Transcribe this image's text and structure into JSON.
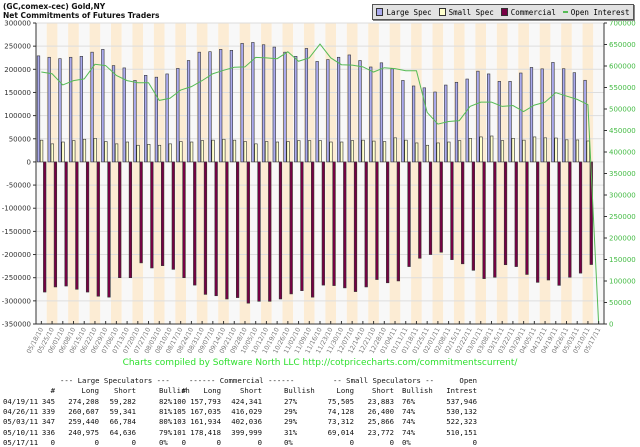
{
  "header": {
    "line1": "(GC,comex-cec) Gold,NY",
    "line2": "Net Commitments of Futures Traders"
  },
  "legend": [
    {
      "label": "Large Spec",
      "color": "#aaaaee",
      "kind": "box"
    },
    {
      "label": "Small Spec",
      "color": "#ffffcc",
      "kind": "box"
    },
    {
      "label": "Commercial",
      "color": "#770044",
      "kind": "box"
    },
    {
      "label": "Open Interest",
      "color": "#55bb55",
      "kind": "line"
    }
  ],
  "credit": "Charts compiled by Software North LLC  http://cotpricecharts.com/commitmentscurrent/",
  "chart_data": {
    "type": "bar",
    "legend_position": "top-right",
    "grid": true,
    "x": [
      "05/18/10",
      "05/25/10",
      "06/01/10",
      "06/08/10",
      "06/15/10",
      "06/22/10",
      "06/29/10",
      "07/06/10",
      "07/13/10",
      "07/20/10",
      "07/27/10",
      "08/03/10",
      "08/10/10",
      "08/17/10",
      "08/24/10",
      "08/31/10",
      "09/07/10",
      "09/14/10",
      "09/21/10",
      "09/28/10",
      "10/05/10",
      "10/12/10",
      "10/19/10",
      "10/26/10",
      "11/02/10",
      "11/09/10",
      "11/16/10",
      "11/23/10",
      "11/30/10",
      "12/07/10",
      "12/14/10",
      "12/21/10",
      "12/28/10",
      "01/04/11",
      "01/11/11",
      "01/18/11",
      "01/25/11",
      "02/01/11",
      "02/08/11",
      "02/15/11",
      "02/22/11",
      "03/01/11",
      "03/08/11",
      "03/15/11",
      "03/22/11",
      "03/29/11",
      "04/05/11",
      "04/12/11",
      "04/19/11",
      "04/26/11",
      "05/03/11",
      "05/10/11",
      "05/17/11"
    ],
    "left_axis": {
      "ylim": [
        -350000,
        300000
      ],
      "step": 50000
    },
    "right_axis": {
      "ylim": [
        0,
        700000
      ],
      "step": 50000
    },
    "series": [
      {
        "name": "Large Spec",
        "axis": "left",
        "type": "bar",
        "values": [
          229000,
          226000,
          223000,
          226000,
          228000,
          237000,
          243000,
          208000,
          203000,
          176000,
          187000,
          183000,
          190000,
          202000,
          219000,
          237000,
          238000,
          243000,
          241000,
          256000,
          258000,
          253000,
          248000,
          237000,
          228000,
          245000,
          217000,
          221000,
          226000,
          231000,
          219000,
          205000,
          214000,
          201000,
          176000,
          164000,
          160000,
          151000,
          166000,
          172000,
          179000,
          196000,
          190000,
          174000,
          174000,
          192000,
          204000,
          201000,
          214926,
          201266,
          192656,
          176339,
          0
        ]
      },
      {
        "name": "Small Spec",
        "axis": "left",
        "type": "bar",
        "values": [
          47000,
          39000,
          43000,
          46000,
          49000,
          51000,
          44000,
          39000,
          43000,
          36000,
          38000,
          36000,
          39000,
          44000,
          43000,
          46000,
          47000,
          49000,
          47000,
          44000,
          39000,
          44000,
          43000,
          44000,
          46000,
          46000,
          46000,
          43000,
          43000,
          46000,
          47000,
          45000,
          44000,
          52000,
          47000,
          41000,
          36000,
          41000,
          43000,
          46000,
          51000,
          54000,
          56000,
          46000,
          51000,
          47000,
          54000,
          52000,
          51622,
          47728,
          47446,
          45242,
          0
        ]
      },
      {
        "name": "Commercial",
        "axis": "left",
        "type": "bar",
        "values": [
          -281000,
          -270000,
          -268000,
          -275000,
          -281000,
          -290000,
          -292000,
          -250000,
          -250000,
          -218000,
          -229000,
          -224000,
          -232000,
          -250000,
          -266000,
          -286000,
          -289000,
          -296000,
          -293000,
          -305000,
          -301000,
          -301000,
          -296000,
          -285000,
          -278000,
          -292000,
          -266000,
          -267000,
          -272000,
          -280000,
          -270000,
          -254000,
          -261000,
          -257000,
          -226000,
          -208000,
          -200000,
          -195000,
          -211000,
          -220000,
          -234000,
          -252000,
          -249000,
          -222000,
          -226000,
          -243000,
          -260000,
          -255000,
          -266548,
          -248994,
          -240102,
          -221581,
          0
        ]
      },
      {
        "name": "Open Interest",
        "axis": "right",
        "type": "line",
        "values": [
          586000,
          582000,
          556000,
          566000,
          570000,
          604000,
          601000,
          578000,
          566000,
          561000,
          561000,
          520000,
          525000,
          544000,
          552000,
          566000,
          582000,
          590000,
          597000,
          598000,
          620000,
          619000,
          617000,
          633000,
          611000,
          619000,
          651000,
          619000,
          603000,
          602000,
          598000,
          586000,
          596000,
          594000,
          589000,
          589000,
          492000,
          465000,
          471000,
          473000,
          506000,
          516000,
          516000,
          506000,
          508000,
          494000,
          509000,
          516000,
          537946,
          530132,
          522323,
          510151,
          0
        ]
      }
    ]
  },
  "table": {
    "group_headers": [
      "--- Large Speculators ---",
      "------ Commercial ------",
      "-- Small Speculators --",
      "Open"
    ],
    "columns": [
      "#",
      "Long",
      "Short",
      "Bullish",
      "#",
      "Long",
      "Short",
      "Bullish",
      "Long",
      "Short",
      "Bullish",
      "Intrest"
    ],
    "rows": [
      [
        "04/19/11",
        "345",
        "274,208",
        "59,282",
        "82%",
        "100",
        "157,793",
        "424,341",
        "27%",
        "75,505",
        "23,883",
        "76%",
        "537,946"
      ],
      [
        "04/26/11",
        "339",
        "260,607",
        "59,341",
        "81%",
        "105",
        "167,035",
        "416,029",
        "29%",
        "74,128",
        "26,400",
        "74%",
        "530,132"
      ],
      [
        "05/03/11",
        "347",
        "259,440",
        "66,784",
        "80%",
        "103",
        "161,934",
        "402,036",
        "29%",
        "73,312",
        "25,866",
        "74%",
        "522,323"
      ],
      [
        "05/10/11",
        "336",
        "240,975",
        "64,636",
        "79%",
        "101",
        "178,418",
        "399,999",
        "31%",
        "69,014",
        "23,772",
        "74%",
        "510,151"
      ],
      [
        "05/17/11",
        "0",
        "0",
        "0",
        "0%",
        "0",
        "0",
        "0",
        "0%",
        "0",
        "0",
        "0%",
        "0"
      ]
    ]
  }
}
